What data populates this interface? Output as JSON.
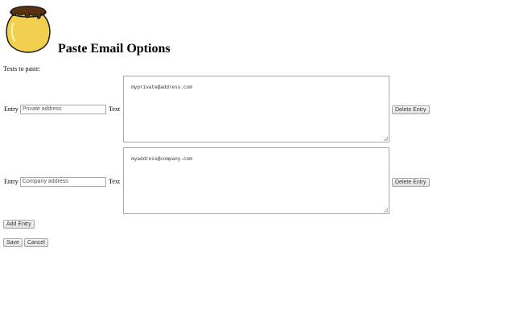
{
  "page": {
    "title": "Paste Email Options",
    "section_label": "Texts to paste:",
    "logo_icon": "honey-pot-icon"
  },
  "entries": [
    {
      "entry_label": "Entry",
      "entry_value": "Private address",
      "text_label": "Text",
      "text_value": "myprivate@address.com",
      "delete_label": "Delete Entry"
    },
    {
      "entry_label": "Entry",
      "entry_value": "Company address",
      "text_label": "Text",
      "text_value": "myaddress@company.com",
      "delete_label": "Delete Entry"
    }
  ],
  "actions": {
    "add_label": "Add Entry",
    "save_label": "Save",
    "cancel_label": "Cancel"
  },
  "colors": {
    "pot_body": "#f2cf4e",
    "pot_honey": "#5a3210",
    "border": "#a9a9a9"
  }
}
